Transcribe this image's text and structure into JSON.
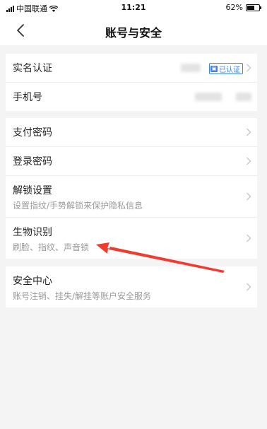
{
  "status_bar": {
    "carrier": "中国联通",
    "time": "11:21",
    "battery": "62%"
  },
  "nav": {
    "title": "账号与安全"
  },
  "group1": {
    "real_name": {
      "title": "实名认证",
      "badge": "已认证"
    },
    "phone": {
      "title": "手机号"
    }
  },
  "group2": {
    "pay_password": {
      "title": "支付密码"
    },
    "login_password": {
      "title": "登录密码"
    },
    "unlock": {
      "title": "解锁设置",
      "subtitle": "设置指纹/手势解锁来保护隐私信息"
    },
    "biometrics": {
      "title": "生物识别",
      "subtitle": "刷脸、指纹、声音锁"
    }
  },
  "group3": {
    "security_center": {
      "title": "安全中心",
      "subtitle": "账号注销、挂失/解挂等账户安全服务"
    }
  },
  "colors": {
    "accent_blue": "#3c83f0",
    "annotation_red": "#f23b2f"
  }
}
